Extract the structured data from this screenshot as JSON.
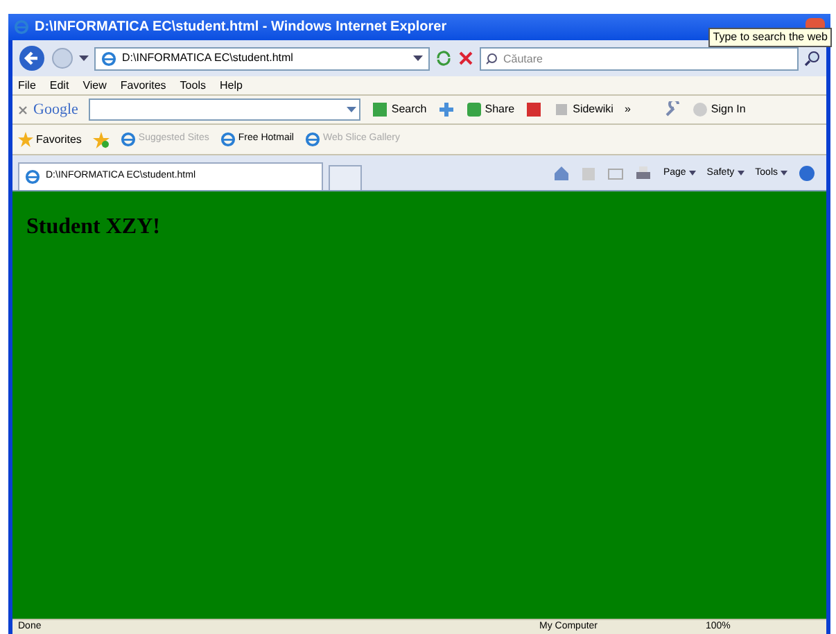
{
  "window": {
    "title": "D:\\INFORMATICA EC\\student.html - Windows Internet Explorer"
  },
  "tooltip": "Type to search the web",
  "address_bar": {
    "value": "D:\\INFORMATICA EC\\student.html"
  },
  "search": {
    "placeholder": "Căutare"
  },
  "menu": [
    "File",
    "Edit",
    "View",
    "Favorites",
    "Tools",
    "Help"
  ],
  "google_toolbar": {
    "brand": "Google",
    "buttons": [
      "Search",
      "Share",
      "Sidewiki",
      "»",
      "Sign In"
    ]
  },
  "favorites_bar": {
    "label": "Favorites",
    "items": [
      {
        "label": "Suggested Sites",
        "disabled": true
      },
      {
        "label": "Free Hotmail",
        "disabled": false
      },
      {
        "label": "Web Slice Gallery",
        "disabled": true
      }
    ]
  },
  "tabs": [
    {
      "label": "D:\\INFORMATICA EC\\student.html",
      "selected": true
    }
  ],
  "command_bar": [
    "Page",
    "Safety",
    "Tools"
  ],
  "page": {
    "heading": "Student XZY!"
  },
  "status_bar": {
    "status": "Done",
    "zone": "My Computer",
    "zoom": "100%"
  }
}
